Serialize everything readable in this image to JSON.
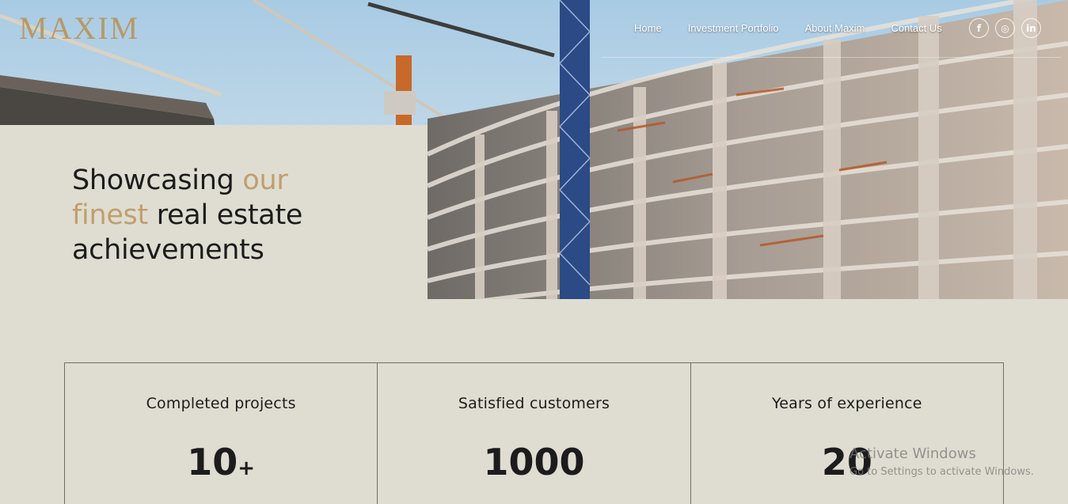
{
  "brand": {
    "logo_text": "MAXIM",
    "accent_color": "#bf9f6e",
    "background_color": "#dfddd1"
  },
  "nav": {
    "items": [
      {
        "label": "Home"
      },
      {
        "label": "Investment Portfolio"
      },
      {
        "label": "About Maxim"
      },
      {
        "label": "Contact Us"
      }
    ]
  },
  "social": {
    "items": [
      {
        "icon": "facebook-icon",
        "glyph": "f"
      },
      {
        "icon": "instagram-icon",
        "glyph": "◎"
      },
      {
        "icon": "linkedin-icon",
        "glyph": "in"
      }
    ]
  },
  "hero": {
    "headline_part1": "Showcasing ",
    "headline_accent1": "our",
    "headline_accent2": "finest",
    "headline_part2": " real estate",
    "headline_part3": "achievements",
    "image": "building-under-construction-photo"
  },
  "stats": [
    {
      "label": "Completed projects",
      "value": "10",
      "suffix": "+"
    },
    {
      "label": "Satisfied customers",
      "value": "1000",
      "suffix": ""
    },
    {
      "label": "Years of experience",
      "value": "20",
      "suffix": ""
    }
  ],
  "watermark": {
    "title": "Activate Windows",
    "subtitle": "Go to Settings to activate Windows."
  }
}
